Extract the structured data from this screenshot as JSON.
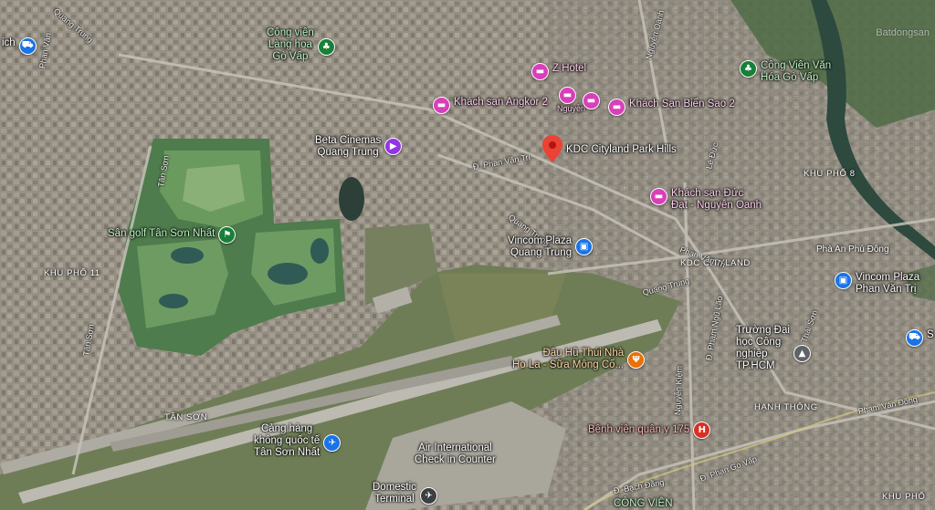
{
  "map": {
    "watermark": "Batdongsan",
    "colors": {
      "urban": "#8f8a80",
      "golf": "#5d8a5c",
      "water": "#2f4a3a",
      "airfield": "#6f7f5a",
      "runway": "#b8b6ae",
      "pin_blue": "#1a73e8",
      "pin_green": "#188038",
      "pin_pink": "#d93fb8",
      "pin_purple": "#9334e6",
      "pin_orange": "#e8710a",
      "pin_red": "#d93025"
    }
  },
  "pois": [
    {
      "id": "ich",
      "label": "ich",
      "icon": "shopping-cart-icon",
      "color": "blue"
    },
    {
      "id": "lang-hoa",
      "label": "Công viên\nLàng hoa\nGò Vấp",
      "icon": "park-tree-icon",
      "color": "green"
    },
    {
      "id": "z-hotel",
      "label": "Z Hotel",
      "icon": "bed-icon",
      "color": "pink"
    },
    {
      "id": "angkor",
      "label": "Khách sạn Angkor 2",
      "icon": "bed-icon",
      "color": "pink"
    },
    {
      "id": "nguyen",
      "label": "Nguyễn",
      "icon": "bed-icon",
      "color": "pink"
    },
    {
      "id": "bien-sao",
      "label": "Khách Sạn Biển Sao 2",
      "icon": "bed-icon",
      "color": "pink"
    },
    {
      "id": "cv-van",
      "label": "Công Viên Văn\nHóa Gò Vấp",
      "icon": "park-tree-icon",
      "color": "green"
    },
    {
      "id": "beta",
      "label": "Beta Cinemas\nQuang Trung",
      "icon": "film-icon",
      "color": "purple"
    },
    {
      "id": "kdc-park",
      "label": "KDC Cityland Park Hills",
      "icon": "location-pin-icon",
      "color": "red"
    },
    {
      "id": "duc-dat",
      "label": "Khách sạn Đức\nĐạt - Nguyễn Oanh",
      "icon": "bed-icon",
      "color": "pink"
    },
    {
      "id": "golf",
      "label": "Sân golf Tân Sơn Nhất",
      "icon": "golf-flag-icon",
      "color": "green"
    },
    {
      "id": "vincom-qt",
      "label": "Vincom Plaza\nQuang Trung",
      "icon": "shopping-bag-icon",
      "color": "blue"
    },
    {
      "id": "vincom-pvt",
      "label": "Vincom Plaza\nPhan Văn Trị",
      "icon": "shopping-bag-icon",
      "color": "blue"
    },
    {
      "id": "right-edge",
      "label": "S",
      "icon": "shopping-cart-icon",
      "color": "blue"
    },
    {
      "id": "dau-hu",
      "label": "Đậu Hũ Thúi Nhà\nHo La - Sữa Mông Cổ...",
      "icon": "restaurant-icon",
      "color": "orange"
    },
    {
      "id": "truong",
      "label": "Trường Đại\nhọc Công\nnghiệp\nTP.HCM",
      "icon": "school-icon",
      "color": "gray"
    },
    {
      "id": "airport",
      "label": "Cảng hàng\nkhông quốc tế\nTân Sơn Nhất",
      "icon": "airplane-icon",
      "color": "blue"
    },
    {
      "id": "benh-vien",
      "label": "Bệnh viện quân y 175",
      "icon": "hospital-icon",
      "color": "red"
    },
    {
      "id": "air-intl",
      "label": "Air International\nCheck in Counter",
      "icon": "",
      "color": "none"
    },
    {
      "id": "domestic",
      "label": "Domestic\nTerminal",
      "icon": "airplane-icon",
      "color": "dark"
    },
    {
      "id": "cong-vien",
      "label": "CÔNG VIÊN",
      "icon": "",
      "color": "none"
    }
  ],
  "areas": [
    {
      "id": "khu-pho-11",
      "label": "KHU PHỐ 11"
    },
    {
      "id": "khu-pho-8",
      "label": "KHU PHỐ 8"
    },
    {
      "id": "kdc-cityland",
      "label": "KDC CITYLAND"
    },
    {
      "id": "hanh-thong",
      "label": "HẠNH THÔNG"
    },
    {
      "id": "khu-pho",
      "label": "KHU PHỐ"
    },
    {
      "id": "tan-son",
      "label": "TÂN SƠN"
    },
    {
      "id": "pha-an-phu-dong",
      "label": "Phà An Phú Đông"
    }
  ],
  "streets": [
    {
      "id": "quang-trung-top",
      "label": "Quang Trung"
    },
    {
      "id": "phan-van-tri-left",
      "label": "Phan Văn"
    },
    {
      "id": "tan-son-st",
      "label": "Tân Sơn"
    },
    {
      "id": "tan-son-st2",
      "label": "Tân Sơn"
    },
    {
      "id": "d-phan-van-tri",
      "label": "Đ. Phan Văn Trị"
    },
    {
      "id": "quang-trung-mid",
      "label": "Quang Trung"
    },
    {
      "id": "quang-trung-east",
      "label": "Quang Trung"
    },
    {
      "id": "nguyen-oanh",
      "label": "Nguyễn Oanh"
    },
    {
      "id": "phan-van-tri-right",
      "label": "Phan Văn Trị"
    },
    {
      "id": "nguyen-kiem",
      "label": "Nguyễn Kiệm"
    },
    {
      "id": "pham-ngu-lao",
      "label": "Đ. Phạm Ngũ Lão"
    },
    {
      "id": "phan-van-dong",
      "label": "Phạm Văn Đồng"
    },
    {
      "id": "bach-dang",
      "label": "Đ. Bạch Đằng"
    },
    {
      "id": "phan-go-vap",
      "label": "Đ. Phan Gò Vấp"
    },
    {
      "id": "thai-son",
      "label": "Thái Sơn"
    },
    {
      "id": "le-duc-tho",
      "label": "Lê Đức"
    }
  ]
}
